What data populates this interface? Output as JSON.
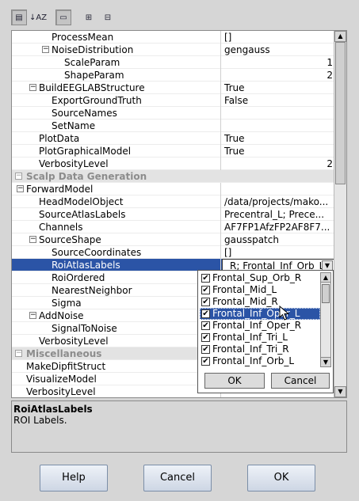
{
  "toolbar": {
    "buttons": [
      {
        "name": "categorized-view-icon",
        "glyph": "▤",
        "pressed": true
      },
      {
        "name": "sort-alpha-icon",
        "glyph": "↓AZ",
        "pressed": false
      },
      {
        "name": "description-toggle-icon",
        "glyph": "▭",
        "pressed": true
      },
      {
        "name": "expand-all-icon",
        "glyph": "⊞",
        "pressed": false
      },
      {
        "name": "collapse-all-icon",
        "glyph": "⊟",
        "pressed": false
      }
    ]
  },
  "properties": {
    "rows": [
      {
        "name": "ProcessMean",
        "value": "[]",
        "indent": 2
      },
      {
        "name": "NoiseDistribution",
        "value": "gengauss",
        "indent": 2,
        "toggle": "−"
      },
      {
        "name": "ScaleParam",
        "value": "1",
        "indent": 3,
        "right": true
      },
      {
        "name": "ShapeParam",
        "value": "2",
        "indent": 3,
        "right": true
      },
      {
        "name": "BuildEEGLABStructure",
        "value": "True",
        "indent": 1,
        "toggle": "−"
      },
      {
        "name": "ExportGroundTruth",
        "value": "False",
        "indent": 2
      },
      {
        "name": "SourceNames",
        "value": "",
        "indent": 2
      },
      {
        "name": "SetName",
        "value": "",
        "indent": 2
      },
      {
        "name": "PlotData",
        "value": "True",
        "indent": 1
      },
      {
        "name": "PlotGraphicalModel",
        "value": "True",
        "indent": 1
      },
      {
        "name": "VerbosityLevel",
        "value": "2",
        "indent": 1,
        "right": true
      },
      {
        "name": "Scalp Data Generation",
        "category": true,
        "toggle": "−"
      },
      {
        "name": "ForwardModel",
        "value": "",
        "indent": 0,
        "toggle": "−"
      },
      {
        "name": "HeadModelObject",
        "value": "/data/projects/mako...",
        "indent": 1
      },
      {
        "name": "SourceAtlasLabels",
        "value": "Precentral_L; Prece...",
        "indent": 1
      },
      {
        "name": "Channels",
        "value": "AF7FP1AfzFP2AF8F7...",
        "indent": 1
      },
      {
        "name": "SourceShape",
        "value": "gausspatch",
        "indent": 1,
        "toggle": "−"
      },
      {
        "name": "SourceCoordinates",
        "value": "[]",
        "indent": 2
      },
      {
        "name": "RoiAtlasLabels",
        "value": "_R; Frontal_Inf_Orb_L",
        "indent": 2,
        "selected": true,
        "combo": true
      },
      {
        "name": "RoiOrdered",
        "value": "",
        "indent": 2
      },
      {
        "name": "NearestNeighbor",
        "value": "",
        "indent": 2
      },
      {
        "name": "Sigma",
        "value": "",
        "indent": 2
      },
      {
        "name": "AddNoise",
        "value": "",
        "indent": 1,
        "toggle": "−"
      },
      {
        "name": "SignalToNoise",
        "value": "",
        "indent": 2
      },
      {
        "name": "VerbosityLevel",
        "value": "",
        "indent": 1
      },
      {
        "name": "Miscellaneous",
        "category": true,
        "toggle": "−"
      },
      {
        "name": "MakeDipfitStruct",
        "value": "",
        "indent": 0
      },
      {
        "name": "VisualizeModel",
        "value": "",
        "indent": 0
      },
      {
        "name": "VerbosityLevel",
        "value": "",
        "indent": 0
      }
    ]
  },
  "description": {
    "title": "RoiAtlasLabels",
    "text": "ROI Labels."
  },
  "popup": {
    "items": [
      {
        "label": "Frontal_Sup_Orb_R",
        "checked": true
      },
      {
        "label": "Frontal_Mid_L",
        "checked": true
      },
      {
        "label": "Frontal_Mid_R",
        "checked": true
      },
      {
        "label": "Frontal_Inf_Oper_L",
        "checked": true,
        "hover": true
      },
      {
        "label": "Frontal_Inf_Oper_R",
        "checked": true
      },
      {
        "label": "Frontal_Inf_Tri_L",
        "checked": true
      },
      {
        "label": "Frontal_Inf_Tri_R",
        "checked": true
      },
      {
        "label": "Frontal_Inf_Orb_L",
        "checked": true
      }
    ],
    "ok_label": "OK",
    "cancel_label": "Cancel"
  },
  "buttons": {
    "help_label": "Help",
    "cancel_label": "Cancel",
    "ok_label": "OK"
  }
}
